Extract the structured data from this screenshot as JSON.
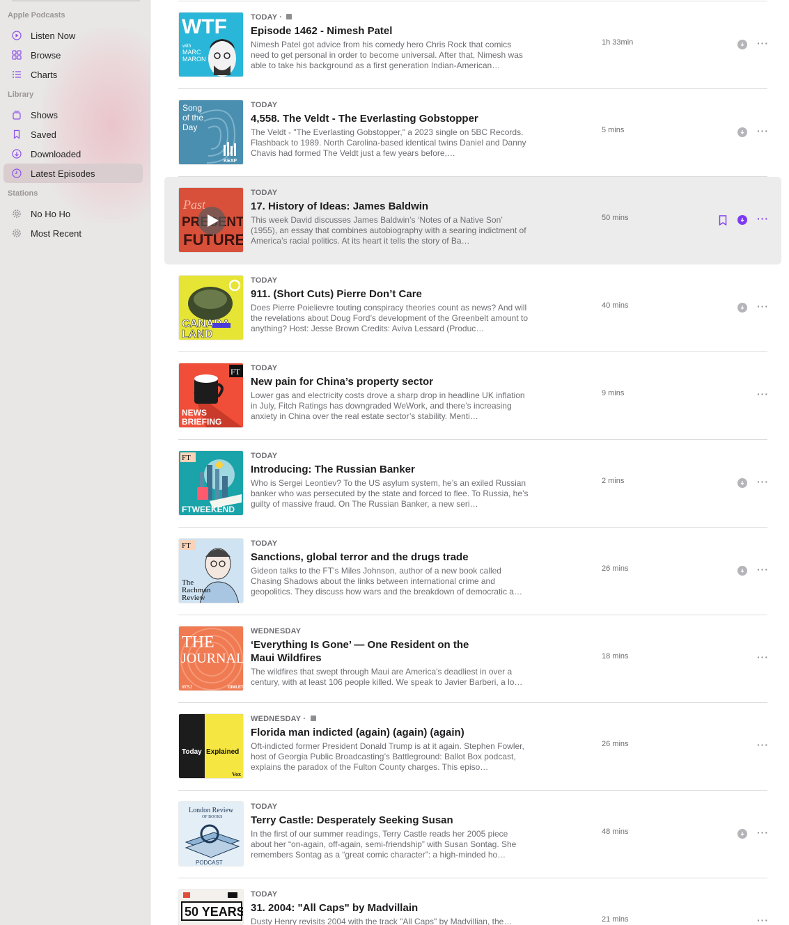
{
  "sidebar": {
    "sections": {
      "apple_podcasts": "Apple Podcasts",
      "library": "Library",
      "stations": "Stations"
    },
    "items": [
      {
        "label": "Listen Now",
        "icon": "play-circle-icon"
      },
      {
        "label": "Browse",
        "icon": "grid-icon"
      },
      {
        "label": "Charts",
        "icon": "list-icon"
      },
      {
        "label": "Shows",
        "icon": "stack-icon"
      },
      {
        "label": "Saved",
        "icon": "bookmark-icon"
      },
      {
        "label": "Downloaded",
        "icon": "download-circle-icon"
      },
      {
        "label": "Latest Episodes",
        "icon": "clock-icon",
        "active": true
      },
      {
        "label": "No Ho Ho",
        "icon": "gear-icon"
      },
      {
        "label": "Most Recent",
        "icon": "gear-icon"
      }
    ]
  },
  "episodes": [
    {
      "day": "TODAY",
      "explicit": true,
      "title": "Episode 1462 - Nimesh Patel",
      "desc": "Nimesh Patel got advice from his comedy hero Chris Rock that comics need to get personal in order to become universal. After that, Nimesh was able to take his background as a first generation Indian-American…",
      "duration": "1h 33min",
      "download": true,
      "art": "wtf-marc-maron-art",
      "art_text": [
        "WTF",
        "with",
        "MARC",
        "MARON"
      ]
    },
    {
      "day": "TODAY",
      "explicit": false,
      "title": "4,558. The Veldt - The Everlasting Gobstopper",
      "desc": "The Veldt - \"The Everlasting Gobstopper,\" a 2023 single on 5BC Records.  Flashback to 1989. North Carolina-based identical twins Daniel and Danny Chavis had formed The Veldt just a few years before,…",
      "duration": "5 mins",
      "download": true,
      "art": "song-of-the-day-art",
      "art_text": [
        "Song",
        "of the",
        "Day",
        "KEXP"
      ]
    },
    {
      "day": "TODAY",
      "explicit": false,
      "title": "17. History of Ideas: James Baldwin",
      "desc": "This week David discusses James Baldwin’s ‘Notes of a Native Son’ (1955), an essay that combines autobiography with a searing indictment of America’s racial politics. At its heart it tells the story of Ba…",
      "duration": "50 mins",
      "download": true,
      "highlighted": true,
      "art": "past-present-future-art",
      "art_text": [
        "Past",
        "PRESENT",
        "FUTURE"
      ]
    },
    {
      "day": "TODAY",
      "explicit": false,
      "title": "911. (Short Cuts) Pierre Don’t Care",
      "desc": "Does Pierre Poielievre touting conspiracy theories count as news? And will the revelations about Doug Ford’s development of the Greenbelt amount to anything? Host: Jesse Brown Credits: Aviva Lessard (Produc…",
      "duration": "40 mins",
      "download": true,
      "art": "canadaland-art",
      "art_text": [
        "CANADA",
        "LAND"
      ]
    },
    {
      "day": "TODAY",
      "explicit": false,
      "title": "New pain for China’s property sector",
      "desc": "Lower gas and electricity costs drove a sharp drop in headline UK inflation in July, Fitch Ratings has downgraded WeWork, and there’s increasing anxiety in China over the real estate sector’s stability.  Menti…",
      "duration": "9 mins",
      "download": false,
      "art": "ft-news-briefing-art",
      "art_text": [
        "FT",
        "NEWS",
        "BRIEFING"
      ]
    },
    {
      "day": "TODAY",
      "explicit": false,
      "title": "Introducing: The Russian Banker",
      "desc": "Who is Sergei Leontiev? To the US asylum system, he’s an exiled Russian banker who was persecuted by the state and forced to flee. To Russia, he’s guilty of massive fraud. On The Russian Banker, a new seri…",
      "duration": "2 mins",
      "download": true,
      "art": "ft-weekend-art",
      "art_text": [
        "FT",
        "FTWEEKEND"
      ]
    },
    {
      "day": "TODAY",
      "explicit": false,
      "title": "Sanctions, global terror and the drugs trade",
      "desc": "Gideon talks to the FT’s Miles Johnson, author of a new book called Chasing Shadows about the links between international crime and geopolitics. They discuss how wars and the breakdown of democratic a…",
      "duration": "26 mins",
      "download": true,
      "art": "rachman-review-art",
      "art_text": [
        "FT",
        "The",
        "Rachman",
        "Review"
      ]
    },
    {
      "day": "WEDNESDAY",
      "explicit": false,
      "title": "‘Everything Is Gone’ — One Resident on the Maui Wildfires",
      "desc": "The wildfires that swept through Maui are America's deadliest in over a century, with at least 106 people killed. We speak to Javier Barberi, a lo…",
      "duration": "18 mins",
      "download": false,
      "art": "the-journal-art",
      "art_text": [
        "THE",
        "JOURNAL.",
        "WSJ",
        "GIMLET"
      ]
    },
    {
      "day": "WEDNESDAY",
      "explicit": true,
      "title": "Florida man indicted (again) (again) (again)",
      "desc": "Oft-indicted former President Donald Trump is at it again. Stephen Fowler, host of Georgia Public Broadcasting’s Battleground: Ballot Box podcast, explains the paradox of the Fulton County charges. This episo…",
      "duration": "26 mins",
      "download": false,
      "art": "today-explained-art",
      "art_text": [
        "Today",
        "Explained",
        "Vox"
      ]
    },
    {
      "day": "TODAY",
      "explicit": false,
      "title": "Terry Castle: Desperately Seeking Susan",
      "desc": "In the first of our summer readings, Terry Castle reads her 2005 piece about her “on-again, off-again, semi-friendship” with Susan Sontag. She remembers Sontag as a “great comic character”: a high-minded ho…",
      "duration": "48 mins",
      "download": true,
      "art": "lrb-podcast-art",
      "art_text": [
        "London Review",
        "OF BOOKS",
        "PODCAST"
      ]
    },
    {
      "day": "TODAY",
      "explicit": false,
      "title": "31. 2004: \"All Caps\" by Madvillain",
      "desc": "Dusty Henry revisits 2004 with the track \"All Caps\" by Madvillian, the…",
      "duration": "21 mins",
      "download": false,
      "art": "fifty-years-art",
      "art_text": [
        "50 YEARS"
      ]
    }
  ],
  "colors": {
    "accent": "#7d3af2",
    "sidebar_bg": "#e9e6e6",
    "active_item": "#d9cdd0"
  }
}
